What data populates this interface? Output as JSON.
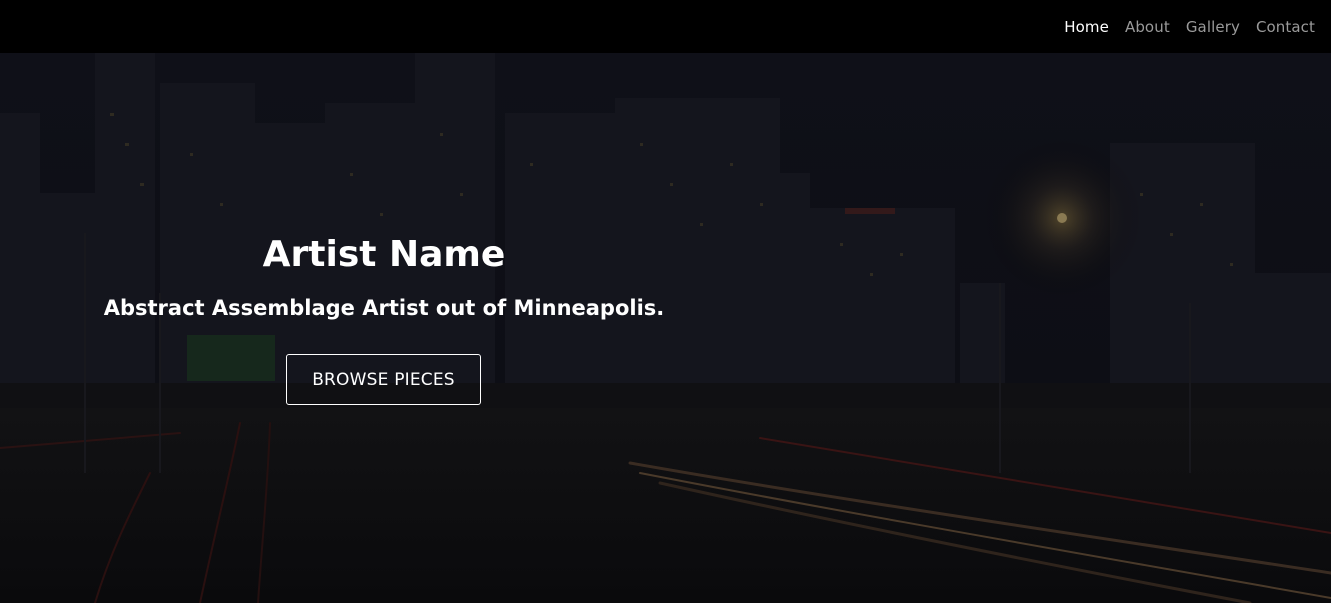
{
  "nav": {
    "items": [
      {
        "label": "Home",
        "active": true
      },
      {
        "label": "About",
        "active": false
      },
      {
        "label": "Gallery",
        "active": false
      },
      {
        "label": "Contact",
        "active": false
      }
    ]
  },
  "hero": {
    "title": "Artist Name",
    "subtitle": "Abstract Assemblage Artist out of Minneapolis.",
    "cta_label": "BROWSE PIECES",
    "background": "night-city-skyline-highway-photo"
  },
  "colors": {
    "nav_bg": "#000000",
    "nav_active": "#ffffff",
    "nav_inactive": "#9a9a9a",
    "hero_text": "#ffffff"
  }
}
